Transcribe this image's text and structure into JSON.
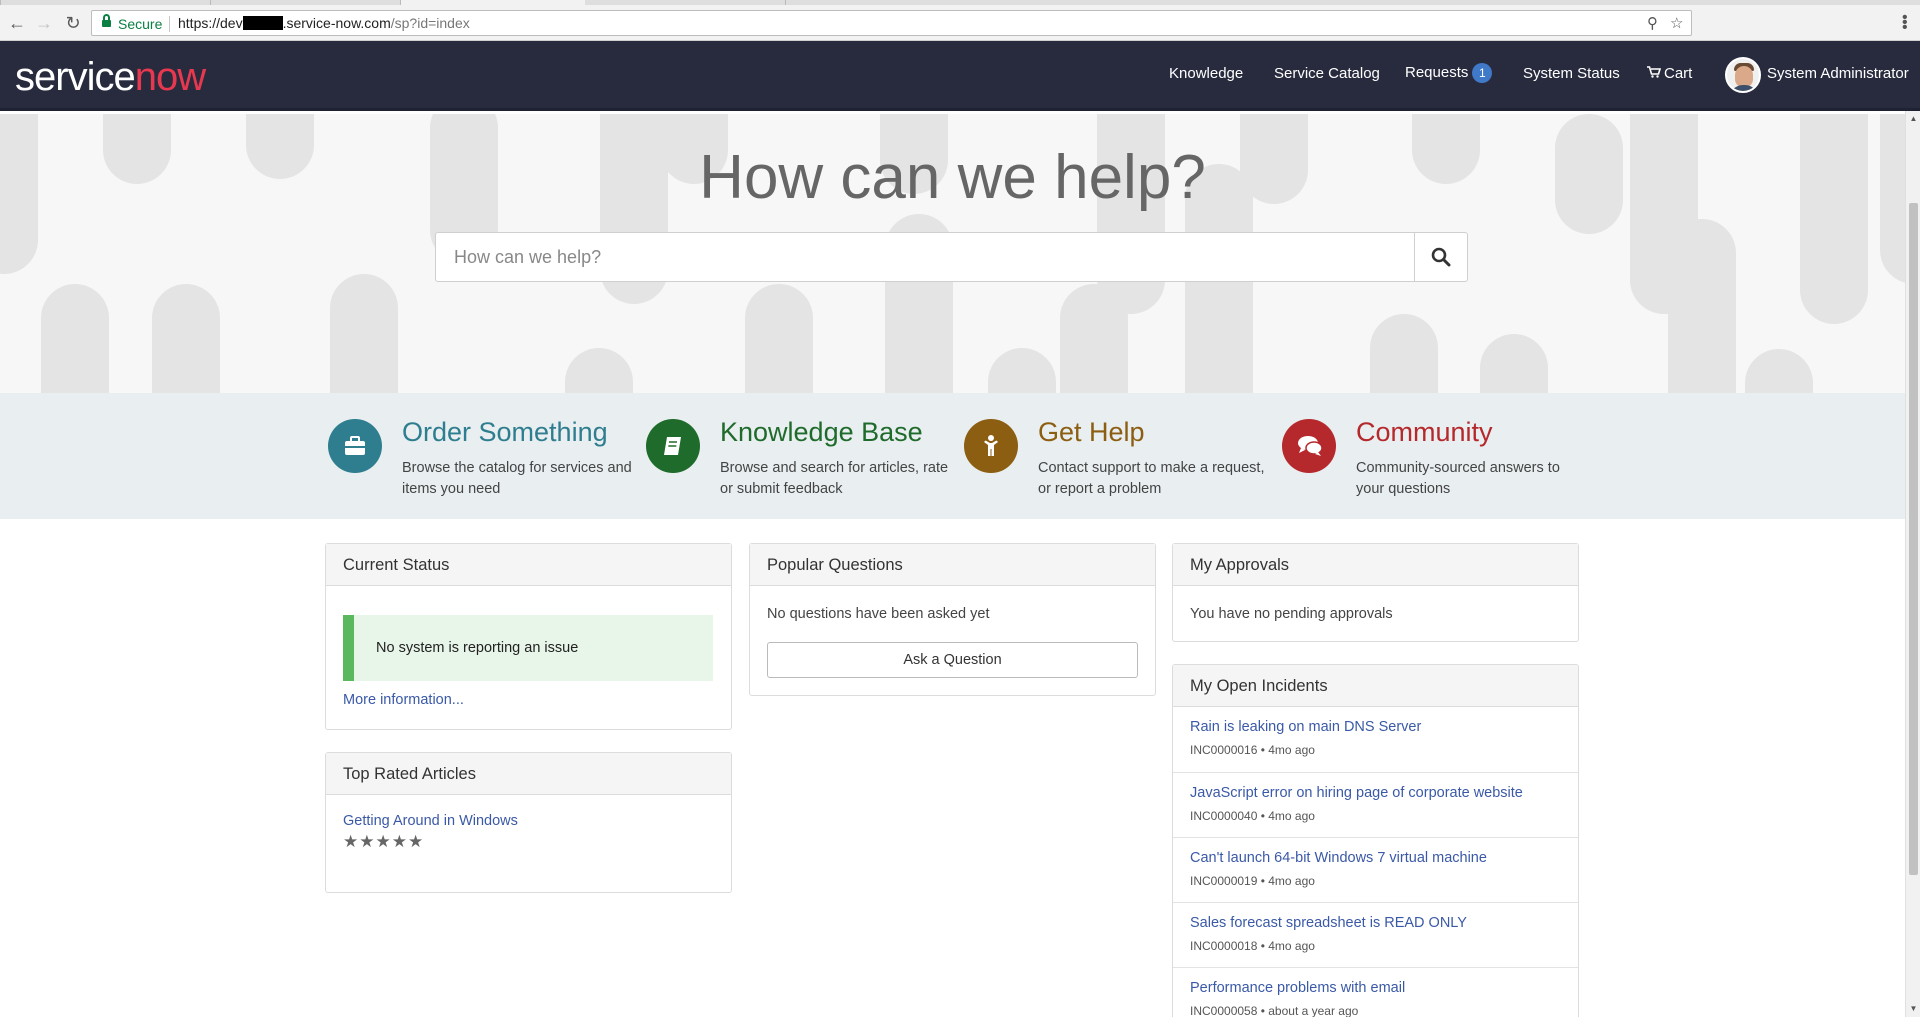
{
  "browser": {
    "secure_label": "Secure",
    "url_prefix": "https://dev",
    "url_domain": ".service-now.com",
    "url_path": "/sp?id=index"
  },
  "header": {
    "logo_service": "service",
    "logo_now": "now",
    "nav": {
      "knowledge": "Knowledge",
      "service_catalog": "Service Catalog",
      "requests": "Requests",
      "requests_badge": "1",
      "system_status": "System Status",
      "cart": "Cart",
      "user": "System Administrator"
    }
  },
  "hero": {
    "title": "How can we help?",
    "search_placeholder": "How can we help?"
  },
  "quick_links": [
    {
      "title": "Order Something",
      "desc": "Browse the catalog for services and items you need",
      "color": "#2e7e8f",
      "icon": "briefcase-icon"
    },
    {
      "title": "Knowledge Base",
      "desc": "Browse and search for articles, rate or submit feedback",
      "color": "#1f6b2b",
      "icon": "book-icon"
    },
    {
      "title": "Get Help",
      "desc": "Contact support to make a request, or report a problem",
      "color": "#8b5e12",
      "icon": "person-icon"
    },
    {
      "title": "Community",
      "desc": "Community-sourced answers to your questions",
      "color": "#b5282c",
      "icon": "chat-icon"
    }
  ],
  "current_status": {
    "heading": "Current Status",
    "message": "No system is reporting an issue",
    "more_link": "More information..."
  },
  "top_rated": {
    "heading": "Top Rated Articles",
    "article": "Getting Around in Windows",
    "stars": "★★★★★",
    "rating": 5
  },
  "popular_questions": {
    "heading": "Popular Questions",
    "empty": "No questions have been asked yet",
    "ask_button": "Ask a Question"
  },
  "my_approvals": {
    "heading": "My Approvals",
    "empty": "You have no pending approvals"
  },
  "my_incidents": {
    "heading": "My Open Incidents",
    "items": [
      {
        "title": "Rain is leaking on main DNS Server",
        "meta": "INC0000016 • 4mo ago"
      },
      {
        "title": "JavaScript error on hiring page of corporate website",
        "meta": "INC0000040 • 4mo ago"
      },
      {
        "title": "Can't launch 64-bit Windows 7 virtual machine",
        "meta": "INC0000019 • 4mo ago"
      },
      {
        "title": "Sales forecast spreadsheet is READ ONLY",
        "meta": "INC0000018 • 4mo ago"
      },
      {
        "title": "Performance problems with email",
        "meta": "INC0000058 • about a year ago"
      }
    ]
  }
}
